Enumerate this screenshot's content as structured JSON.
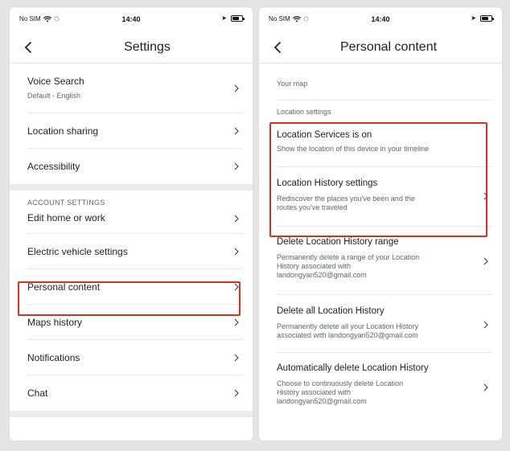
{
  "accent_color": "#d93025",
  "left": {
    "status": {
      "carrier": "No SIM",
      "time": "14:40"
    },
    "header": {
      "title": "Settings"
    },
    "items": {
      "voice_search": {
        "title": "Voice Search",
        "subtitle": "Default - English"
      },
      "location_sharing": {
        "title": "Location sharing"
      },
      "accessibility": {
        "title": "Accessibility"
      },
      "account_section": "ACCOUNT SETTINGS",
      "edit_home": {
        "title": "Edit home or work"
      },
      "ev_settings": {
        "title": "Electric vehicle settings"
      },
      "personal_content": {
        "title": "Personal content"
      },
      "maps_history": {
        "title": "Maps history"
      },
      "notifications": {
        "title": "Notifications"
      },
      "chat": {
        "title": "Chat"
      }
    }
  },
  "right": {
    "status": {
      "carrier": "No SIM",
      "time": "14:40"
    },
    "header": {
      "title": "Personal content"
    },
    "your_map": "Your map",
    "location_settings": "Location settings",
    "items": {
      "location_services": {
        "title": "Location Services is on",
        "subtitle": "Show the location of this device in your timeline"
      },
      "location_history_settings": {
        "title": "Location History settings",
        "subtitle_line1": "Rediscover the places you've been and the",
        "subtitle_line2": "routes you've traveled"
      },
      "delete_range": {
        "title": "Delete Location History range",
        "subtitle_line1": "Permanently delete a range of your Location",
        "subtitle_line2": "History associated with",
        "subtitle_line3": "landongyan520@gmail.com"
      },
      "delete_all": {
        "title": "Delete all Location History",
        "subtitle_line1": "Permanently delete all your Location History",
        "subtitle_line2": "associated with landongyan520@gmail.com"
      },
      "auto_delete": {
        "title": "Automatically delete Location History",
        "subtitle_line1": "Choose to continuously delete Location",
        "subtitle_line2": "History associated with",
        "subtitle_line3": "landongyan520@gmail.com"
      }
    }
  }
}
